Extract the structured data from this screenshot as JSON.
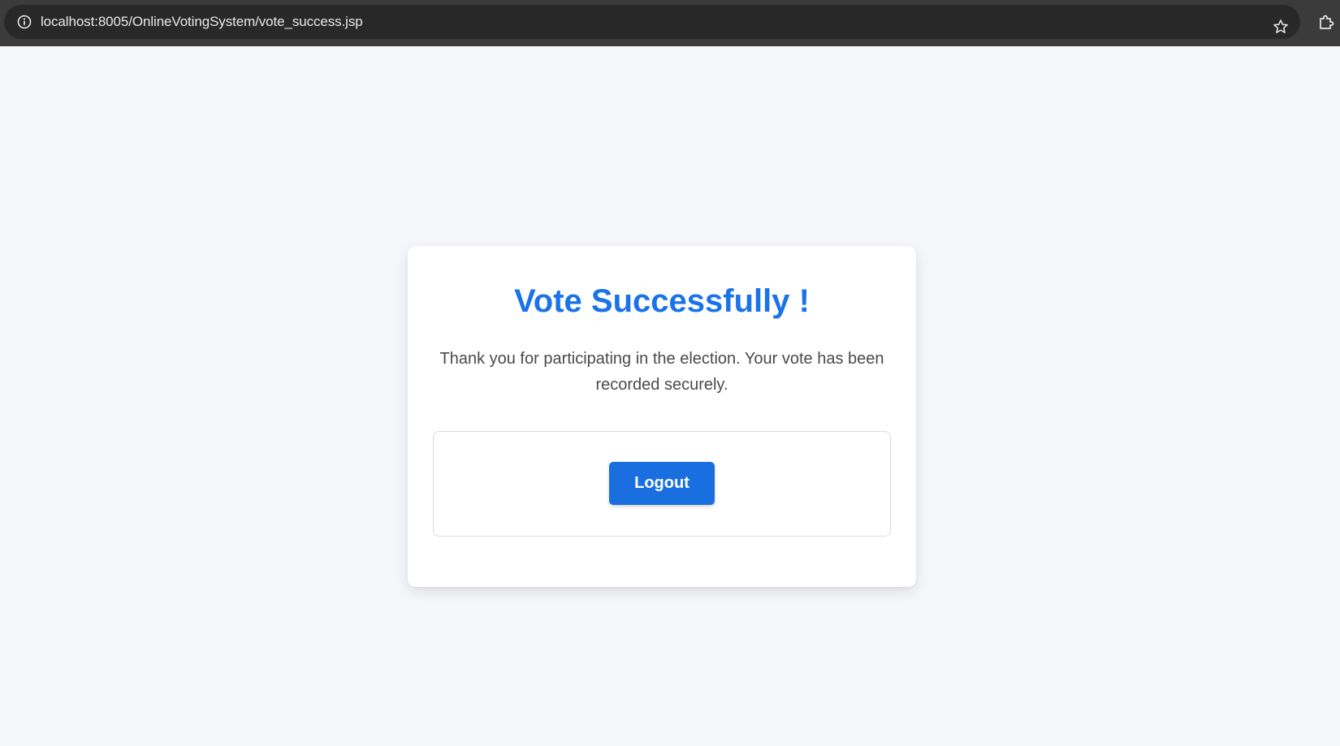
{
  "browser": {
    "url": "localhost:8005/OnlineVotingSystem/vote_success.jsp",
    "icons": {
      "site_info": "info-icon",
      "bookmark": "star-icon",
      "extensions": "puzzle-icon"
    }
  },
  "card": {
    "title": "Vote Successfully !",
    "message": "Thank you for participating in the election. Your vote has been recorded securely.",
    "logout_label": "Logout"
  },
  "colors": {
    "accent": "#1a73e8",
    "button": "#1a6fe0",
    "page_background": "#f5f7fa",
    "browser_bar": "#3b3b3b"
  }
}
